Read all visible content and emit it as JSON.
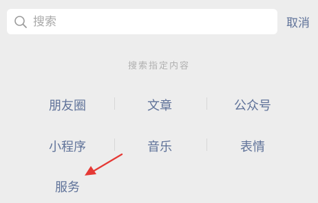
{
  "search": {
    "placeholder": "搜索",
    "value": ""
  },
  "cancel_label": "取消",
  "section_title": "搜索指定内容",
  "categories": [
    {
      "label": "朋友圈"
    },
    {
      "label": "文章"
    },
    {
      "label": "公众号"
    },
    {
      "label": "小程序"
    },
    {
      "label": "音乐"
    },
    {
      "label": "表情"
    },
    {
      "label": "服务"
    }
  ],
  "colors": {
    "background": "#ededed",
    "link": "#5f7299",
    "hint": "#b0b0b0",
    "annotation_arrow": "#e53935"
  }
}
